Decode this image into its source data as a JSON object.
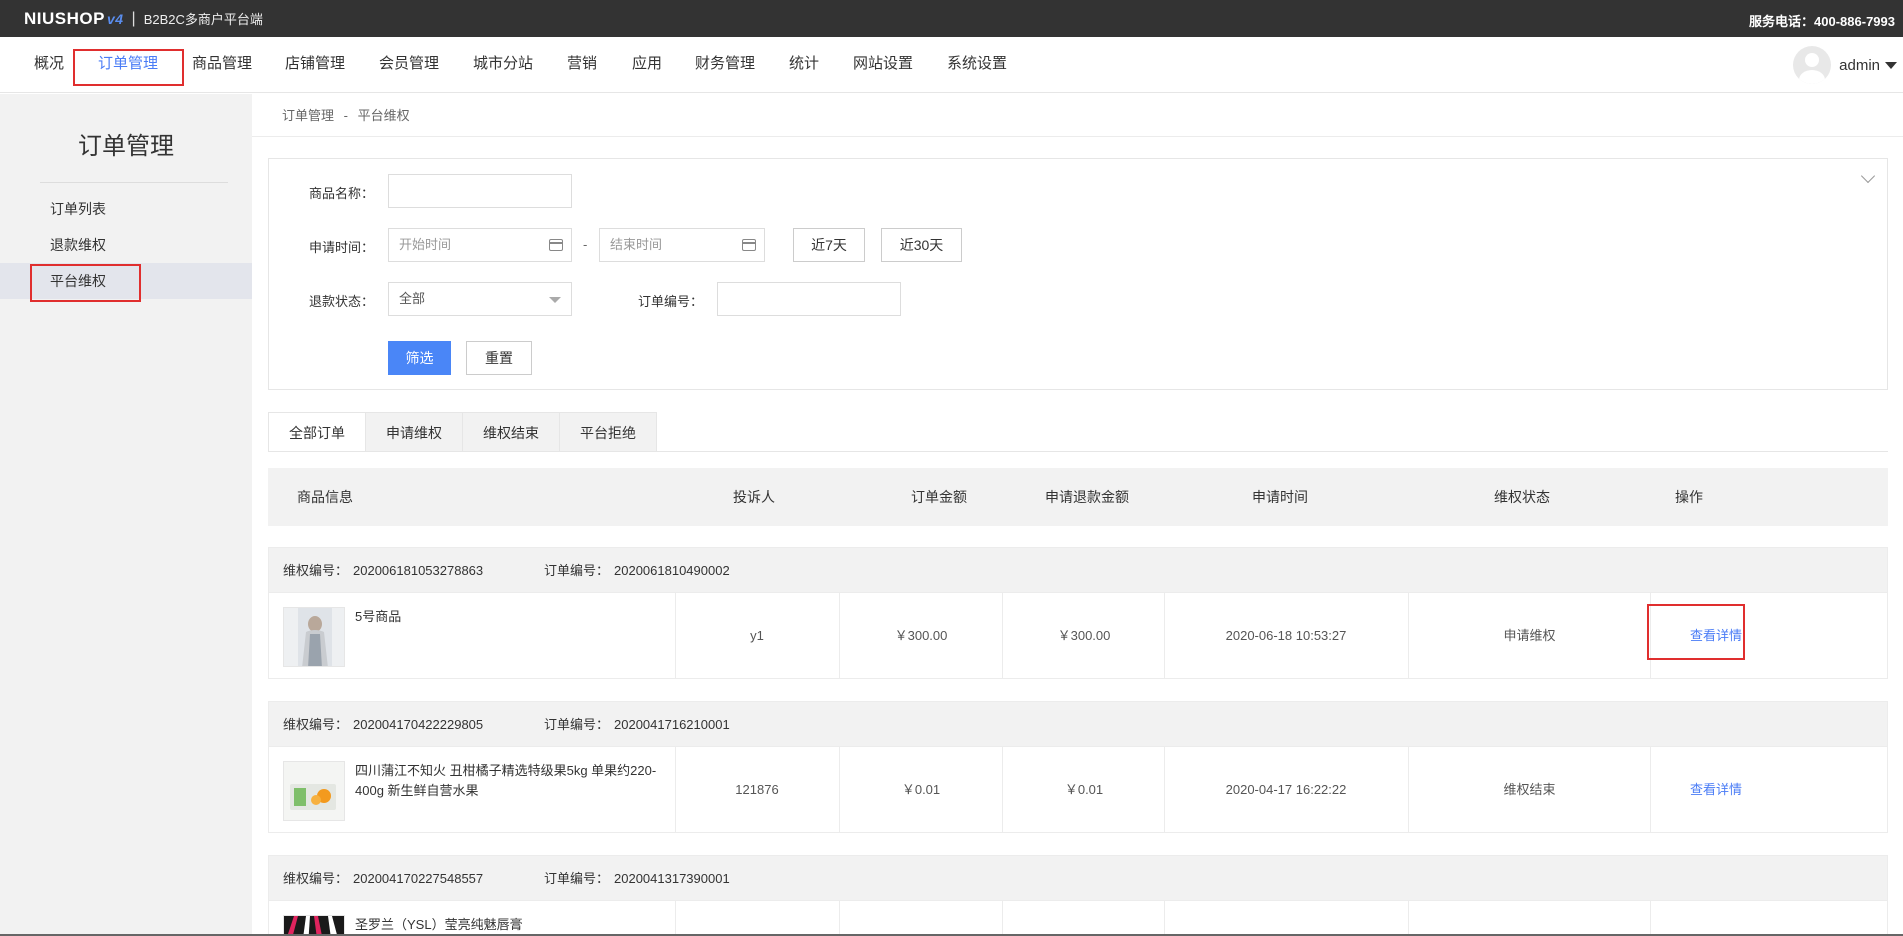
{
  "topbar": {
    "logo": "NIUSHOP",
    "logo_version": "v4",
    "subtitle": "B2B2C多商户平台端",
    "service": "服务电话：400-886-7993"
  },
  "nav": {
    "items": [
      "概况",
      "订单管理",
      "商品管理",
      "店铺管理",
      "会员管理",
      "城市分站",
      "营销",
      "应用",
      "财务管理",
      "统计",
      "网站设置",
      "系统设置"
    ],
    "active": "订单管理",
    "user": "admin"
  },
  "sidebar": {
    "title": "订单管理",
    "items": [
      "订单列表",
      "退款维权",
      "平台维权"
    ],
    "active": "平台维权"
  },
  "breadcrumb": [
    "订单管理",
    "-",
    "平台维权"
  ],
  "filter": {
    "goods_name_label": "商品名称：",
    "goods_name_value": "",
    "apply_time_label": "申请时间：",
    "start_placeholder": "开始时间",
    "end_placeholder": "结束时间",
    "dash": "-",
    "btn_7days": "近7天",
    "btn_30days": "近30天",
    "refund_status_label": "退款状态：",
    "refund_status_value": "全部",
    "order_no_label": "订单编号：",
    "order_no_value": "",
    "submit": "筛选",
    "reset": "重置"
  },
  "tabs": [
    "全部订单",
    "申请维权",
    "维权结束",
    "平台拒绝"
  ],
  "table": {
    "headers": [
      "商品信息",
      "投诉人",
      "订单金额",
      "申请退款金额",
      "申请时间",
      "维权状态",
      "操作"
    ],
    "groups": [
      {
        "rights_no_label": "维权编号：",
        "rights_no": "202006181053278863",
        "order_no_label": "订单编号：",
        "order_no": "2020061810490002",
        "goods_name": "5号商品",
        "complainant": "y1",
        "order_amount": "￥300.00",
        "refund_amount": "￥300.00",
        "apply_time": "2020-06-18 10:53:27",
        "status": "申请维权",
        "action": "查看详情"
      },
      {
        "rights_no_label": "维权编号：",
        "rights_no": "202004170422229805",
        "order_no_label": "订单编号：",
        "order_no": "2020041716210001",
        "goods_name": "四川蒲江不知火 丑柑橘子精选特级果5kg 单果约220-400g 新生鲜自营水果",
        "complainant": "121876",
        "order_amount": "￥0.01",
        "refund_amount": "￥0.01",
        "apply_time": "2020-04-17 16:22:22",
        "status": "维权结束",
        "action": "查看详情"
      },
      {
        "rights_no_label": "维权编号：",
        "rights_no": "202004170227548557",
        "order_no_label": "订单编号：",
        "order_no": "2020041317390001",
        "goods_name": "圣罗兰（YSL）莹亮纯魅唇膏"
      }
    ]
  },
  "colors": {
    "accent": "#4a7cf6",
    "primary_button": "#4a86f7",
    "highlight_box": "#e02e2e",
    "topbar": "#333333"
  }
}
